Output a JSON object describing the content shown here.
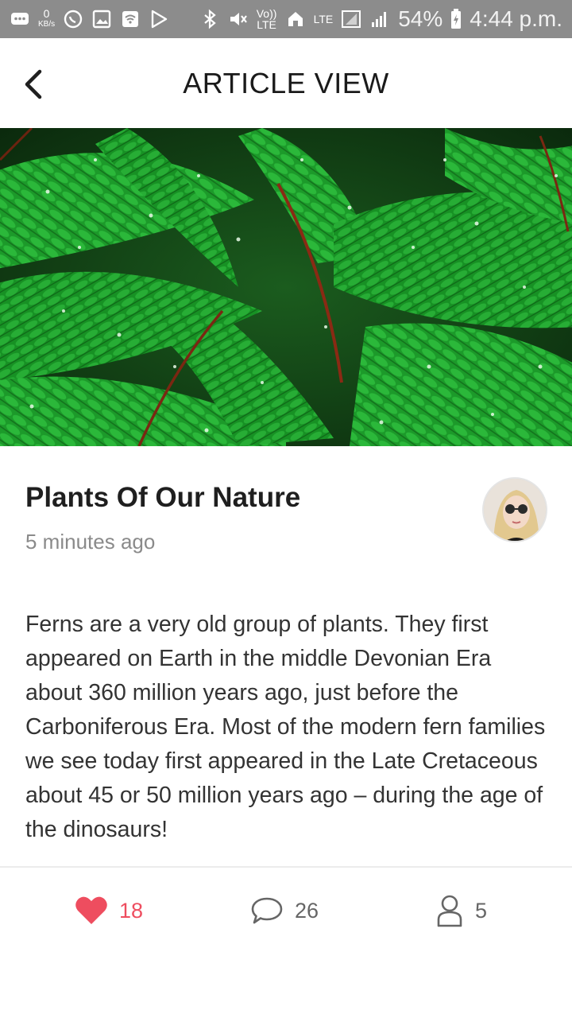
{
  "status_bar": {
    "network_speed_value": "0",
    "network_speed_unit": "KB/s",
    "battery_percent": "54%",
    "time": "4:44 p.m.",
    "lte_label": "LTE",
    "volte_label": "Vo)) LTE",
    "icons": [
      "message-icon",
      "whatsapp-icon",
      "gallery-icon",
      "wifi-icon",
      "play-store-icon",
      "bluetooth-icon",
      "mute-icon",
      "volte-icon",
      "home-icon",
      "lte-icon",
      "signal-icon",
      "battery-charging-icon"
    ]
  },
  "app_bar": {
    "title": "ARTICLE VIEW",
    "back_icon": "chevron-left-icon"
  },
  "article": {
    "hero_image": "fern-leaves-with-raindrops",
    "title": "Plants Of Our Nature",
    "time_ago": "5 minutes ago",
    "author_avatar": "woman-with-sunglasses",
    "body": "Ferns are a very old group of plants. They first appeared on Earth in the middle Devonian Era about 360 million years ago, just before the Carboniferous Era. Most of the modern fern families we see today first appeared in the Late Cretaceous about 45 or 50 million years ago – during the age of the dinosaurs!"
  },
  "actions": {
    "likes": "18",
    "comments": "26",
    "shares": "5",
    "like_color": "#ee4d5f",
    "icons": [
      "heart-icon",
      "comment-bubble-icon",
      "user-icon"
    ]
  },
  "colors": {
    "status_bar_bg": "#8c8c8c",
    "hero_green": "#1f9e2a",
    "accent_red": "#ee4d5f",
    "text_primary": "#1f1f1f",
    "text_secondary": "#8a8a8a"
  }
}
